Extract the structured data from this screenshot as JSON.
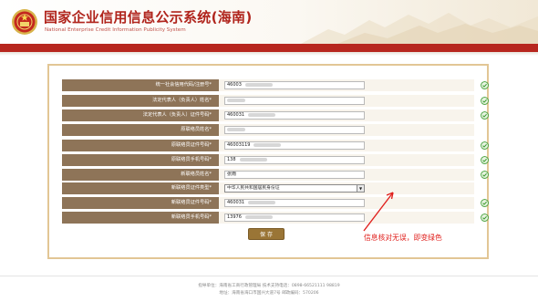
{
  "header": {
    "title": "国家企业信用信息公示系统(海南)",
    "subtitle": "National Enterprise Credit Information Publicity System"
  },
  "form": {
    "rows": [
      {
        "label": "统一社会信用代码/注册号*",
        "value": "46003",
        "type": "text"
      },
      {
        "label": "法定代表人（负责人）姓名*",
        "value": "",
        "type": "text"
      },
      {
        "label": "法定代表人（负责人）证件号码*",
        "value": "460031",
        "type": "text"
      },
      {
        "label": "原联络员姓名*",
        "value": "",
        "type": "text"
      },
      {
        "label": "原联络员证件号码*",
        "value": "46003119",
        "type": "text"
      },
      {
        "label": "原联络员手机号码*",
        "value": "138",
        "type": "text"
      },
      {
        "label": "新联络员姓名*",
        "value": "张雨",
        "type": "text"
      },
      {
        "label": "新联络员证件类型*",
        "value": "中华人民共和国居民身份证",
        "type": "select"
      },
      {
        "label": "新联络员证件号码*",
        "value": "460031",
        "type": "text"
      },
      {
        "label": "新联络员手机号码*",
        "value": "13976",
        "type": "text"
      }
    ],
    "save_label": "保 存"
  },
  "annotation": {
    "note": "信息核对无误，即变绿色",
    "color": "#e0201d"
  },
  "footer": {
    "line1": "指导单位：海南省工商行政管理局  技术支持电话：0898-66521111 98819",
    "line2": "地址：海南省海口市国兴大道7号  邮政编码：570206"
  },
  "colors": {
    "brand_red": "#b7261e",
    "label_bg": "#8e7458",
    "form_border": "#e2c695",
    "check_green": "#3c9c2f"
  },
  "icons": {
    "emblem": "national-emblem-icon",
    "status": "check-circle-icon",
    "dropdown": "dropdown-arrow-icon"
  }
}
